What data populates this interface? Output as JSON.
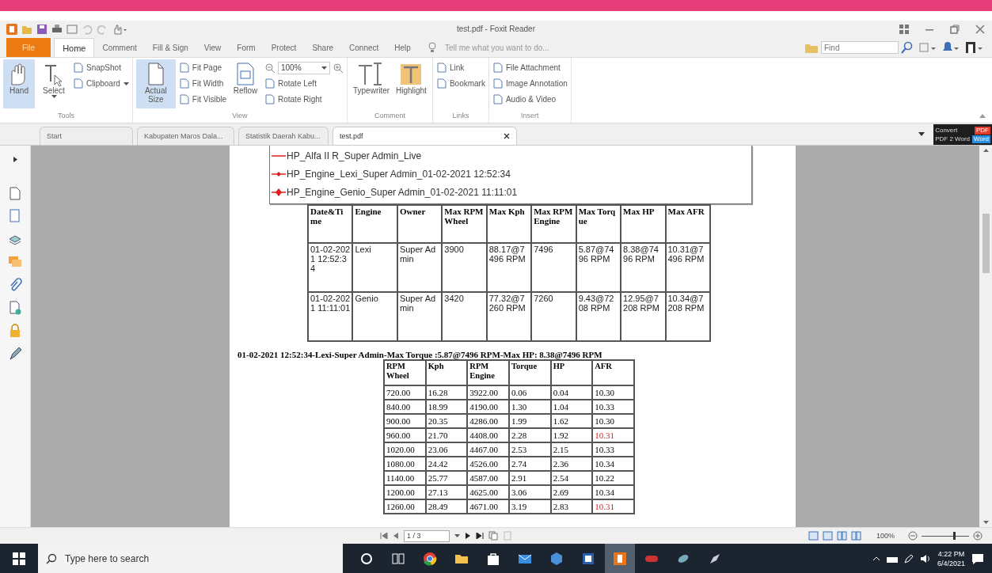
{
  "window": {
    "title": "test.pdf - Foxit Reader"
  },
  "menu_tabs": [
    {
      "label": "File",
      "kind": "file",
      "selected": false
    },
    {
      "label": "Home",
      "kind": "tab",
      "selected": true
    },
    {
      "label": "Comment",
      "kind": "tab",
      "selected": false
    },
    {
      "label": "Fill & Sign",
      "kind": "tab",
      "selected": false
    },
    {
      "label": "View",
      "kind": "tab",
      "selected": false
    },
    {
      "label": "Form",
      "kind": "tab",
      "selected": false
    },
    {
      "label": "Protect",
      "kind": "tab",
      "selected": false
    },
    {
      "label": "Share",
      "kind": "tab",
      "selected": false
    },
    {
      "label": "Connect",
      "kind": "tab",
      "selected": false
    },
    {
      "label": "Help",
      "kind": "tab",
      "selected": false
    }
  ],
  "tell_me": {
    "placeholder": "Tell me what you want to do..."
  },
  "find": {
    "placeholder": "Find"
  },
  "ribbon_groups": [
    {
      "label": "Tools",
      "items": [
        {
          "kind": "large",
          "label": "Hand",
          "selected": true,
          "dropdown": false
        },
        {
          "kind": "large",
          "label": "Select",
          "selected": false,
          "dropdown": true
        },
        {
          "kind": "column",
          "items": [
            {
              "kind": "small",
              "label": "SnapShot",
              "dropdown": false
            },
            {
              "kind": "small",
              "label": "Clipboard",
              "dropdown": true
            }
          ]
        }
      ]
    },
    {
      "label": "View",
      "items": [
        {
          "kind": "large",
          "label": "Actual Size",
          "selected": true,
          "dropdown": false
        },
        {
          "kind": "column",
          "items": [
            {
              "kind": "small",
              "label": "Fit Page",
              "dropdown": false
            },
            {
              "kind": "small",
              "label": "Fit Width",
              "dropdown": false
            },
            {
              "kind": "small",
              "label": "Fit Visible",
              "dropdown": false
            }
          ]
        },
        {
          "kind": "large",
          "label": "Reflow",
          "selected": false,
          "dropdown": false
        },
        {
          "kind": "column",
          "items": [
            {
              "kind": "zoom",
              "value": "100%"
            },
            {
              "kind": "small",
              "label": "Rotate Left",
              "dropdown": false
            },
            {
              "kind": "small",
              "label": "Rotate Right",
              "dropdown": false
            }
          ]
        }
      ]
    },
    {
      "label": "Comment",
      "items": [
        {
          "kind": "large",
          "label": "Typewriter",
          "selected": false,
          "dropdown": false
        },
        {
          "kind": "large",
          "label": "Highlight",
          "selected": false,
          "dropdown": false
        }
      ]
    },
    {
      "label": "Links",
      "items": [
        {
          "kind": "column",
          "items": [
            {
              "kind": "small",
              "label": "Link",
              "dropdown": false
            },
            {
              "kind": "small",
              "label": "Bookmark",
              "dropdown": false
            }
          ]
        }
      ]
    },
    {
      "label": "Insert",
      "items": [
        {
          "kind": "column",
          "items": [
            {
              "kind": "small",
              "label": "File Attachment",
              "dropdown": false
            },
            {
              "kind": "small",
              "label": "Image Annotation",
              "dropdown": false
            },
            {
              "kind": "small",
              "label": "Audio & Video",
              "dropdown": false
            }
          ]
        }
      ]
    }
  ],
  "doc_tabs": [
    {
      "label": "Start",
      "selected": false,
      "closable": false
    },
    {
      "label": "Kabupaten Maros Dala...",
      "selected": false,
      "closable": false
    },
    {
      "label": "Statistik Daerah Kabu...",
      "selected": false,
      "closable": false
    },
    {
      "label": "test.pdf",
      "selected": true,
      "closable": true
    }
  ],
  "convert_banner": {
    "line_1": "Convert",
    "line_2": "PDF 2 Word",
    "badge_top": "PDF",
    "badge_bottom": "Word"
  },
  "legend": [
    {
      "kind": "line",
      "label": "HP_Alfa II R_Super Admin_Live"
    },
    {
      "kind": "marker",
      "label": "HP_Engine_Lexi_Super Admin_01-02-2021 12:52:34"
    },
    {
      "kind": "big_marker",
      "label": "HP_Engine_Genio_Super Admin_01-02-2021 11:11:01"
    }
  ],
  "summary_table": {
    "columns": [
      "Date&Time",
      "Engine",
      "Owner",
      "Max RPM Wheel",
      "Max Kph",
      "Max RPM Engine",
      "Max Torque",
      "Max HP",
      "Max AFR"
    ],
    "rows": [
      [
        "01-02-2021 12:52:34",
        "Lexi",
        "Super Admin",
        "3900",
        "88.17@7496 RPM",
        "7496",
        "5.87@7496 RPM",
        "8.38@7496 RPM",
        "10.31@7496 RPM"
      ],
      [
        "01-02-2021 11:11:01",
        "Genio",
        "Super Admin",
        "3420",
        "77.32@7260 RPM",
        "7260",
        "9.43@7208 RPM",
        "12.95@7208 RPM",
        "10.34@7208 RPM"
      ]
    ]
  },
  "run_caption": "01-02-2021 12:52:34-Lexi-Super Admin-Max Torque :5.87@7496 RPM-Max HP: 8.38@7496 RPM",
  "run_table": {
    "columns": [
      "RPM Wheel",
      "Kph",
      "RPM Engine",
      "Torque",
      "HP",
      "AFR"
    ],
    "rows": [
      {
        "cells": [
          "720.00",
          "16.28",
          "3922.00",
          "0.06",
          "0.04",
          "10.30"
        ],
        "afr_alert": false
      },
      {
        "cells": [
          "840.00",
          "18.99",
          "4190.00",
          "1.30",
          "1.04",
          "10.33"
        ],
        "afr_alert": false
      },
      {
        "cells": [
          "900.00",
          "20.35",
          "4286.00",
          "1.99",
          "1.62",
          "10.30"
        ],
        "afr_alert": false
      },
      {
        "cells": [
          "960.00",
          "21.70",
          "4408.00",
          "2.28",
          "1.92",
          "10.31"
        ],
        "afr_alert": true
      },
      {
        "cells": [
          "1020.00",
          "23.06",
          "4467.00",
          "2.53",
          "2.15",
          "10.33"
        ],
        "afr_alert": false
      },
      {
        "cells": [
          "1080.00",
          "24.42",
          "4526.00",
          "2.74",
          "2.36",
          "10.34"
        ],
        "afr_alert": false
      },
      {
        "cells": [
          "1140.00",
          "25.77",
          "4587.00",
          "2.91",
          "2.54",
          "10.22"
        ],
        "afr_alert": false
      },
      {
        "cells": [
          "1200.00",
          "27.13",
          "4625.00",
          "3.06",
          "2.69",
          "10.34"
        ],
        "afr_alert": false
      },
      {
        "cells": [
          "1260.00",
          "28.49",
          "4671.00",
          "3.19",
          "2.83",
          "10.31"
        ],
        "afr_alert": true
      }
    ]
  },
  "status_bar": {
    "page": "1 / 3",
    "zoom": "100%",
    "zoom_slider": {
      "level": 0.68
    }
  },
  "taskbar": {
    "search_placeholder": "Type here to search",
    "time": "4:22 PM",
    "date": "6/4/2021"
  }
}
